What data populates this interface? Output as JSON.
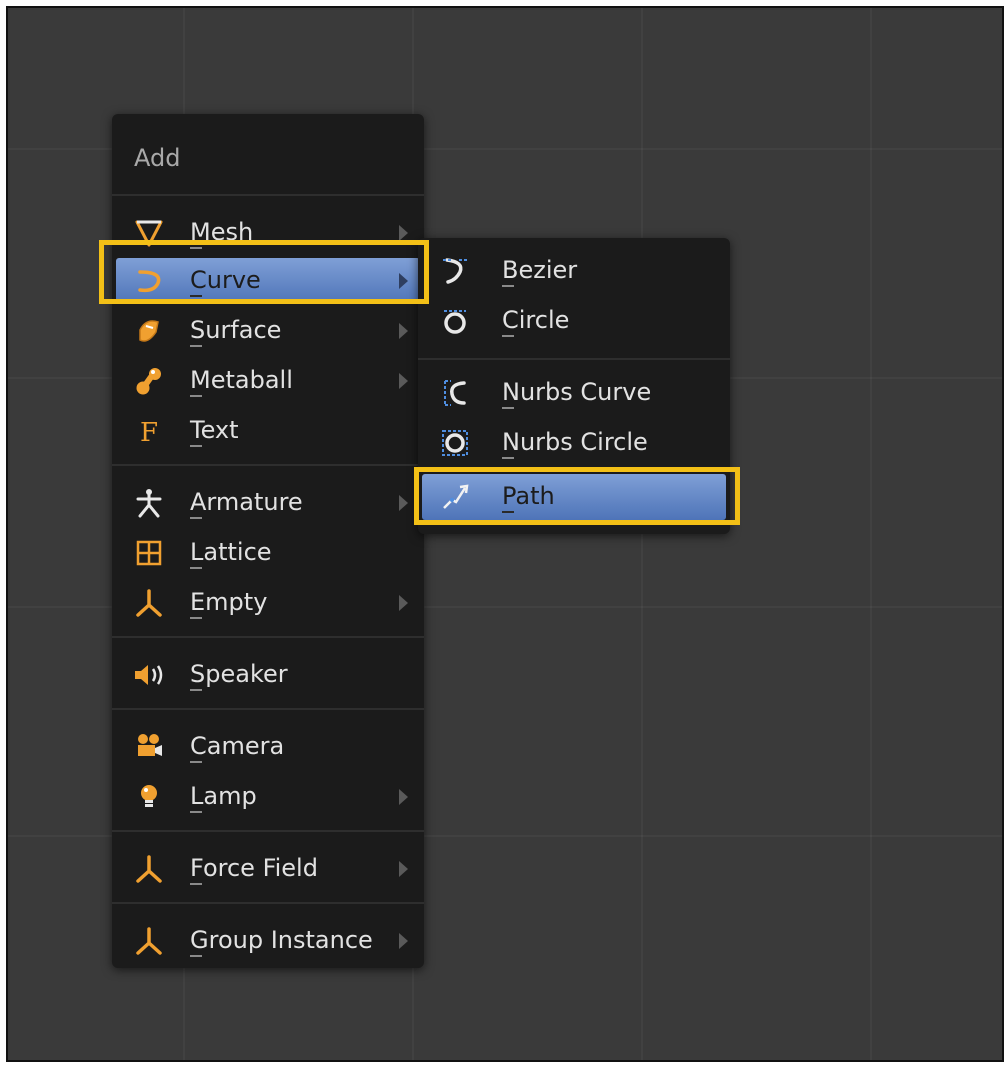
{
  "menu": {
    "title": "Add",
    "items": [
      {
        "label": "Mesh",
        "icon": "mesh-icon",
        "submenu": true
      },
      {
        "label": "Curve",
        "icon": "curve-icon",
        "submenu": true,
        "active": true
      },
      {
        "label": "Surface",
        "icon": "surface-icon",
        "submenu": true
      },
      {
        "label": "Metaball",
        "icon": "metaball-icon",
        "submenu": true
      },
      {
        "label": "Text",
        "icon": "text-icon",
        "submenu": false
      },
      {
        "label": "Armature",
        "icon": "armature-icon",
        "submenu": true
      },
      {
        "label": "Lattice",
        "icon": "lattice-icon",
        "submenu": false
      },
      {
        "label": "Empty",
        "icon": "empty-icon",
        "submenu": true
      },
      {
        "label": "Speaker",
        "icon": "speaker-icon",
        "submenu": false
      },
      {
        "label": "Camera",
        "icon": "camera-icon",
        "submenu": false
      },
      {
        "label": "Lamp",
        "icon": "lamp-icon",
        "submenu": true
      },
      {
        "label": "Force Field",
        "icon": "force-field-icon",
        "submenu": true
      },
      {
        "label": "Group Instance",
        "icon": "group-instance-icon",
        "submenu": true
      }
    ]
  },
  "submenu": {
    "items": [
      {
        "label": "Bezier",
        "icon": "bezier-icon"
      },
      {
        "label": "Circle",
        "icon": "circle-icon"
      },
      {
        "label": "Nurbs Curve",
        "icon": "nurbs-curve-icon"
      },
      {
        "label": "Nurbs Circle",
        "icon": "nurbs-circle-icon"
      },
      {
        "label": "Path",
        "icon": "path-icon",
        "active": true
      }
    ]
  },
  "colors": {
    "highlight_border": "#f3c017",
    "active_item": "#6589c8",
    "icon_orange": "#f0a030",
    "icon_blue": "#4f8ee0",
    "menu_bg": "#1b1b1b",
    "viewport_bg": "#3a3a3a"
  }
}
